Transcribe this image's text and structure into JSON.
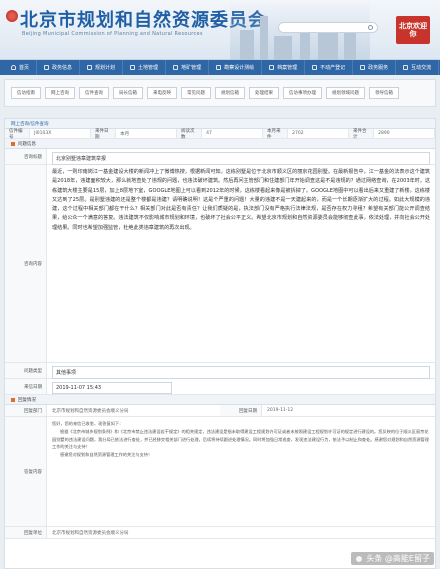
{
  "header": {
    "title": "北京市规划和自然资源委员会",
    "subtitle": "Beijing Municipal Commission of Planning and Natural Resources",
    "search_placeholder": "",
    "seal_text": "北京欢迎你"
  },
  "nav": {
    "items": [
      {
        "label": "首页",
        "icon": "home-icon"
      },
      {
        "label": "政务信息",
        "icon": "info-icon"
      },
      {
        "label": "规划计划",
        "icon": "plan-icon"
      },
      {
        "label": "土地管理",
        "icon": "land-icon"
      },
      {
        "label": "地矿管理",
        "icon": "mine-icon"
      },
      {
        "label": "勘察设计测绘",
        "icon": "survey-icon"
      },
      {
        "label": "档案管理",
        "icon": "archive-icon"
      },
      {
        "label": "不动产登记",
        "icon": "realestate-icon"
      },
      {
        "label": "政务服务",
        "icon": "service-icon"
      },
      {
        "label": "互动交流",
        "icon": "chat-icon"
      }
    ]
  },
  "tabs": [
    "信访指南",
    "网上咨询",
    "信件查询",
    "局长信箱",
    "来电反映",
    "常见问题",
    "规划信箱",
    "处理结果",
    "信访事项办理",
    "规划领域问题",
    "领导信箱"
  ],
  "breadcrumb": "网上咨询/信件查询",
  "meta": {
    "fields": [
      {
        "label": "信件编号",
        "value": "JI0103X"
      },
      {
        "label": "来件日期",
        "value": "本月"
      },
      {
        "label": "阅读次数",
        "value": "47"
      },
      {
        "label": "本月来件",
        "value": "2702"
      },
      {
        "label": "来件合计",
        "value": "2890"
      }
    ]
  },
  "section_question": {
    "heading": "问题信息",
    "subject_label": "咨询标题",
    "subject": "北京别墅违章建筑举报",
    "body_label": "咨询内容",
    "body": "最近，一则印南岗江一基金建设大楼的新闻冲上了微博热搜，根据新闻可知，这栋别墅是位于北京市顺义区的丽京花园别墅。在最新报告中，江一基金的法表示这个建筑是2018年，违建面积较大，那么就地查处了违规的问题，也违法破坏建筑。然后再问主管部门和住建部门年开始调查这是不是违规的？通过网络查询，在2003年时，这栋建筑大楼主要是15层，加上8层地下室，GOOGLE地图上可以看到2012年的时候，这栋楼看起来像是被拆掉了。GOOGLE地图中可以看出后来又重建了新楼，这栋楼又达到了25层。是别墅违建的还是整个楼都是违建？请明确说明！这是个严重的问题！大量的违建不是一天建起来的，而是一个长期逐渐扩大的过程。如此大规模的违建，这个过程中相关部门都在干什么？相关部门对此是否有责任？让我们质疑的是，执法部门没有严格执行法律法规，是否存在权力寻租？希望有关部门能公开调查结果，给公众一个满意的答复。违法建筑不仅影响城市规划和环境，也破坏了社会公平正义。希望北京市规划和自然资源委员会能够彻查此事，依法处理，并向社会公开处理结果。同时也希望加强监管，杜绝此类违章建筑的再次出现。"
  },
  "section_type": {
    "label": "问题类型",
    "value": "其他事项"
  },
  "section_date": {
    "label": "来信日期",
    "value": "2019-11-07 15:43"
  },
  "section_reply": {
    "heading": "回复情况",
    "unit_label": "回复部门",
    "unit": "北京市规划和自然资源委员会顺义分局",
    "date_label": "回复日期",
    "date": "2019-11-12",
    "content_label": "答复内容",
    "greeting": "您好，您的来信已收悉，现答复如下：",
    "reply": "根据《北京市城乡规划条例》和《北京市禁止违法建设若干规定》的相关规定，违法建设是指未取得建设工程规划许可证或者未按照建设工程规划许可证的规定进行建设的。您反映的位于顺义区丽京花园别墅的违法建设问题，我分局已依法进行查处，并已经移交相关部门进行处理，后续将持续跟进处理情况。同时将加强日常巡查，发现违法建设行为，依法予以制止和查处。感谢您对规划和自然资源管理工作的关注与支持！",
    "thanks": "感谢您对规划和自然资源管理工作的关注与支持！",
    "footer_label": "回复单位",
    "footer": "北京市规划和自然资源委员会顺义分局"
  },
  "watermark": "头条 @高能E留子"
}
